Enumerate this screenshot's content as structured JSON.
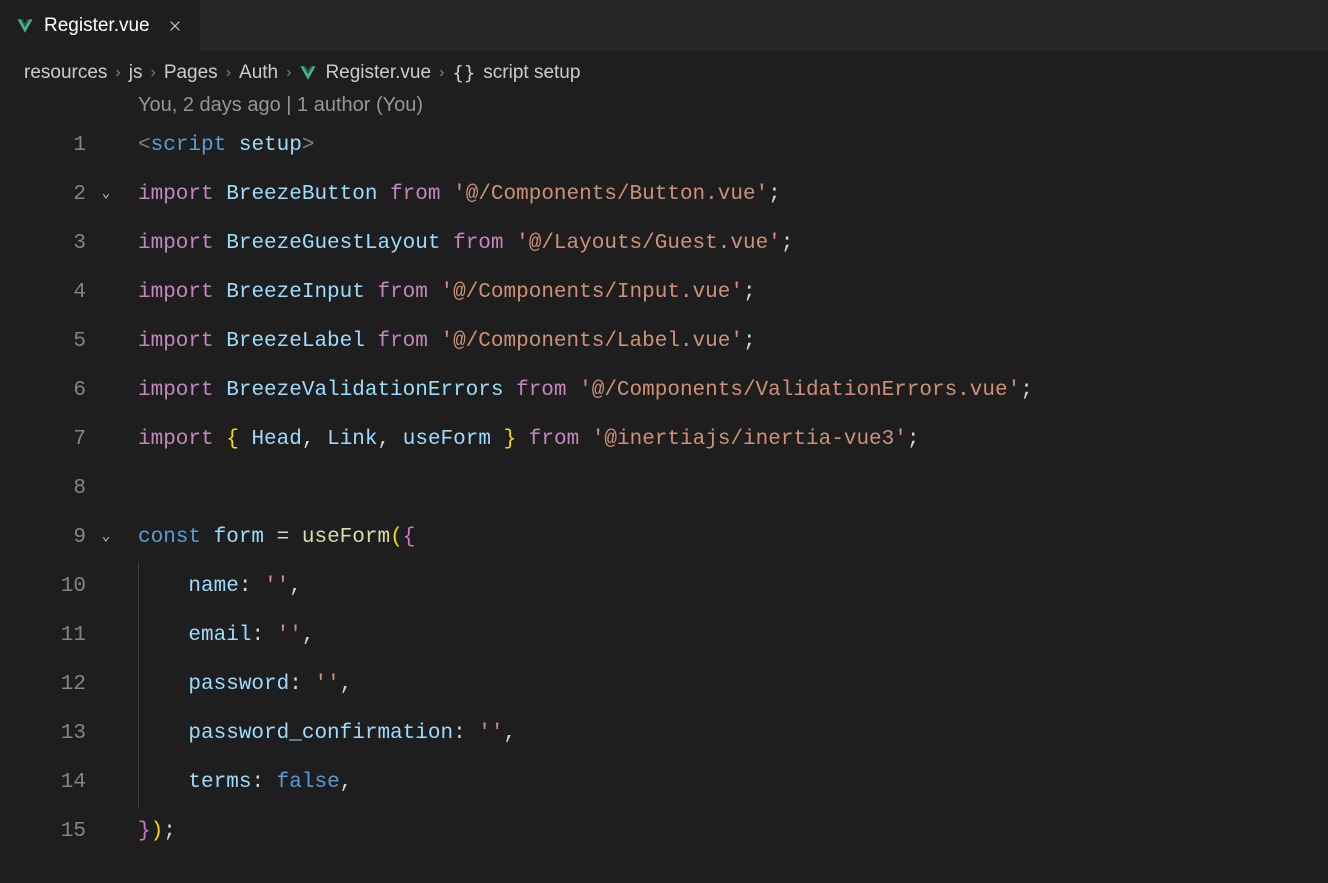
{
  "tab": {
    "filename": "Register.vue"
  },
  "breadcrumb": {
    "items": [
      "resources",
      "js",
      "Pages",
      "Auth",
      "Register.vue",
      "script setup"
    ]
  },
  "annotation": "You, 2 days ago | 1 author (You)",
  "lines": {
    "numbers": [
      "1",
      "2",
      "3",
      "4",
      "5",
      "6",
      "7",
      "8",
      "9",
      "10",
      "11",
      "12",
      "13",
      "14",
      "15"
    ]
  },
  "code": {
    "l1_bracket_open": "<",
    "l1_tag": "script",
    "l1_attr": "setup",
    "l1_bracket_close": ">",
    "import_kw": "import",
    "from_kw": "from",
    "semicolon": ";",
    "comma": ",",
    "colon": ":",
    "l2_id": "BreezeButton",
    "l2_str": "'@/Components/Button.vue'",
    "l3_id": "BreezeGuestLayout",
    "l3_str": "'@/Layouts/Guest.vue'",
    "l4_id": "BreezeInput",
    "l4_str": "'@/Components/Input.vue'",
    "l5_id": "BreezeLabel",
    "l5_str": "'@/Components/Label.vue'",
    "l6_id": "BreezeValidationErrors",
    "l6_str": "'@/Components/ValidationErrors.vue'",
    "l7_id1": "Head",
    "l7_id2": "Link",
    "l7_id3": "useForm",
    "l7_str": "'@inertiajs/inertia-vue3'",
    "l9_const": "const",
    "l9_var": "form",
    "l9_eq": "=",
    "l9_func": "useForm",
    "l9_paren_open": "(",
    "l9_brace_open": "{",
    "l10_key": "name",
    "l10_val": "''",
    "l11_key": "email",
    "l11_val": "''",
    "l12_key": "password",
    "l12_val": "''",
    "l13_key": "password_confirmation",
    "l13_val": "''",
    "l14_key": "terms",
    "l14_val": "false",
    "l15_brace_close": "}",
    "l15_paren_close": ")",
    "brace_open": "{",
    "brace_close": "}"
  }
}
